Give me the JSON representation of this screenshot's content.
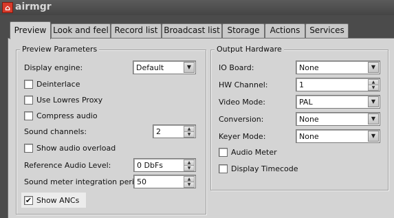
{
  "window": {
    "title": "airmgr",
    "icon": "app-logo-icon"
  },
  "tabs": [
    {
      "label": "Preview",
      "active": true
    },
    {
      "label": "Look and feel"
    },
    {
      "label": "Record list"
    },
    {
      "label": "Broadcast list"
    },
    {
      "label": "Storage"
    },
    {
      "label": "Actions"
    },
    {
      "label": "Services"
    }
  ],
  "preview_params": {
    "title": "Preview Parameters",
    "display_engine": {
      "label": "Display engine:",
      "value": "Default"
    },
    "deinterlace": {
      "label": "Deinterlace",
      "checked": false
    },
    "use_lowres_proxy": {
      "label": "Use Lowres Proxy",
      "checked": false
    },
    "compress_audio": {
      "label": "Compress audio",
      "checked": false
    },
    "sound_channels": {
      "label": "Sound channels:",
      "value": "2"
    },
    "show_audio_overload": {
      "label": "Show audio overload",
      "checked": false
    },
    "reference_audio_level": {
      "label": "Reference Audio Level:",
      "value": "0 DbFs"
    },
    "sound_meter_period": {
      "label": "Sound meter integration period:",
      "value": "50"
    },
    "show_ancs": {
      "label": "Show ANCs",
      "checked": true,
      "mark": "✔"
    }
  },
  "output_hardware": {
    "title": "Output Hardware",
    "io_board": {
      "label": "IO Board:",
      "value": "None"
    },
    "hw_channel": {
      "label": "HW Channel:",
      "value": "1"
    },
    "video_mode": {
      "label": "Video Mode:",
      "value": "PAL"
    },
    "conversion": {
      "label": "Conversion:",
      "value": "None"
    },
    "keyer_mode": {
      "label": "Keyer Mode:",
      "value": "None"
    },
    "audio_meter": {
      "label": "Audio Meter",
      "checked": false
    },
    "display_timecode": {
      "label": "Display Timecode",
      "checked": false
    }
  }
}
